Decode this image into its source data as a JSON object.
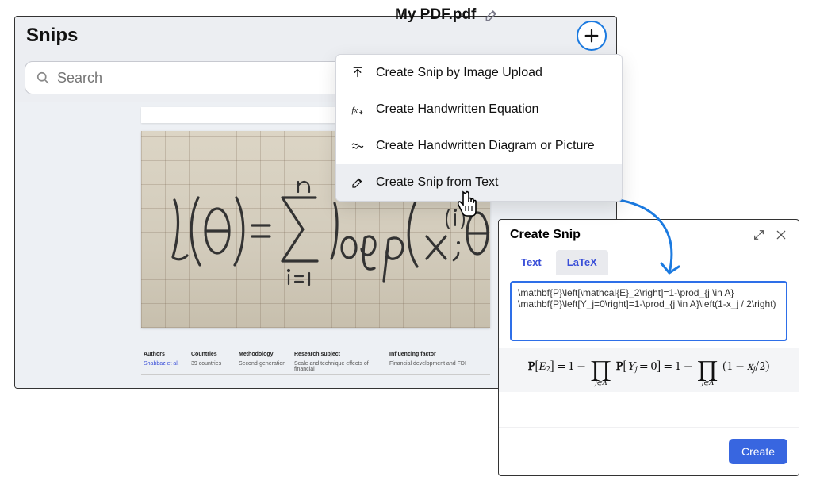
{
  "panel": {
    "title": "Snips",
    "search_placeholder": "Search",
    "doc_title": "My PDF.pdf"
  },
  "handwriting_equation_alt": "l(θ) = Σ_{i=1}^{n} log p(x^{(i)}; θ)",
  "mock_table": {
    "headers": [
      "Authors",
      "Countries",
      "Methodology",
      "Research subject",
      "Influencing factor"
    ],
    "row": [
      "Shabbaz et al.",
      "39 countries",
      "Second-generation",
      "Scale and technique effects of financial",
      "Financial development and FDI"
    ]
  },
  "menu": {
    "items": [
      "Create Snip by Image Upload",
      "Create Handwritten Equation",
      "Create Handwritten Diagram or Picture",
      "Create Snip from Text"
    ]
  },
  "dialog": {
    "title": "Create Snip",
    "tabs": [
      "Text",
      "LaTeX"
    ],
    "active_tab": 1,
    "latex_source": "\\mathbf{P}\\left[\\mathcal{E}_2\\right]=1-\\prod_{j \\in A} \\mathbf{P}\\left[Y_j=0\\right]=1-\\prod_{j \\in A}\\left(1-x_j / 2\\right)",
    "create_label": "Create"
  }
}
